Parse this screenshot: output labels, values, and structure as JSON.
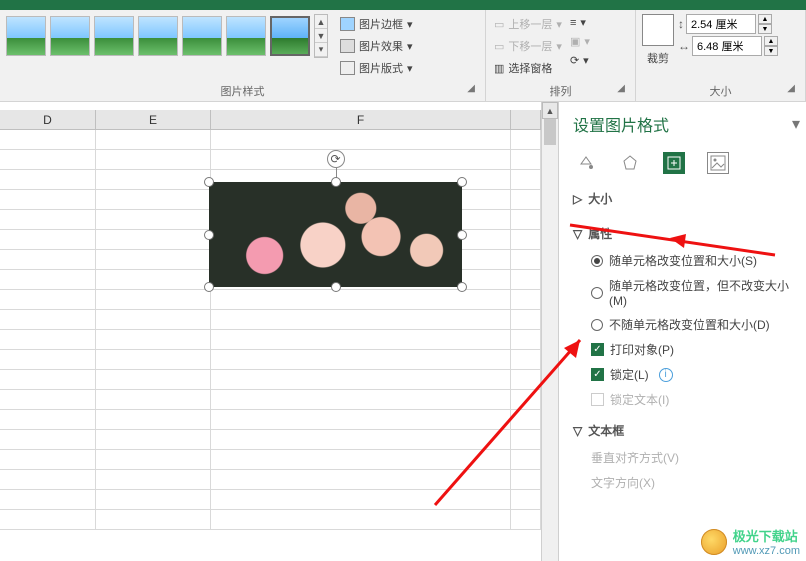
{
  "ribbon": {
    "pic_border": "图片边框",
    "pic_effect": "图片效果",
    "pic_layout": "图片版式",
    "group_styles": "图片样式",
    "bring_fwd": "上移一层",
    "send_back": "下移一层",
    "sel_pane": "选择窗格",
    "group_arrange": "排列",
    "crop": "裁剪",
    "group_size": "大小",
    "height": "2.54 厘米",
    "width": "6.48 厘米"
  },
  "columns": {
    "d": "D",
    "e": "E",
    "f": "F"
  },
  "pane": {
    "title": "设置图片格式",
    "size_hdr": "大小",
    "props_hdr": "属性",
    "opt1": "随单元格改变位置和大小(S)",
    "opt2": "随单元格改变位置，但不改变大小(M)",
    "opt3": "不随单元格改变位置和大小(D)",
    "print": "打印对象(P)",
    "lock": "锁定(L)",
    "locktext": "锁定文本(I)",
    "textbox_hdr": "文本框",
    "valign": "垂直对齐方式(V)",
    "dir": "文字方向(X)"
  },
  "watermark": {
    "line1": "极光下载站",
    "line2": "www.xz7.com"
  }
}
